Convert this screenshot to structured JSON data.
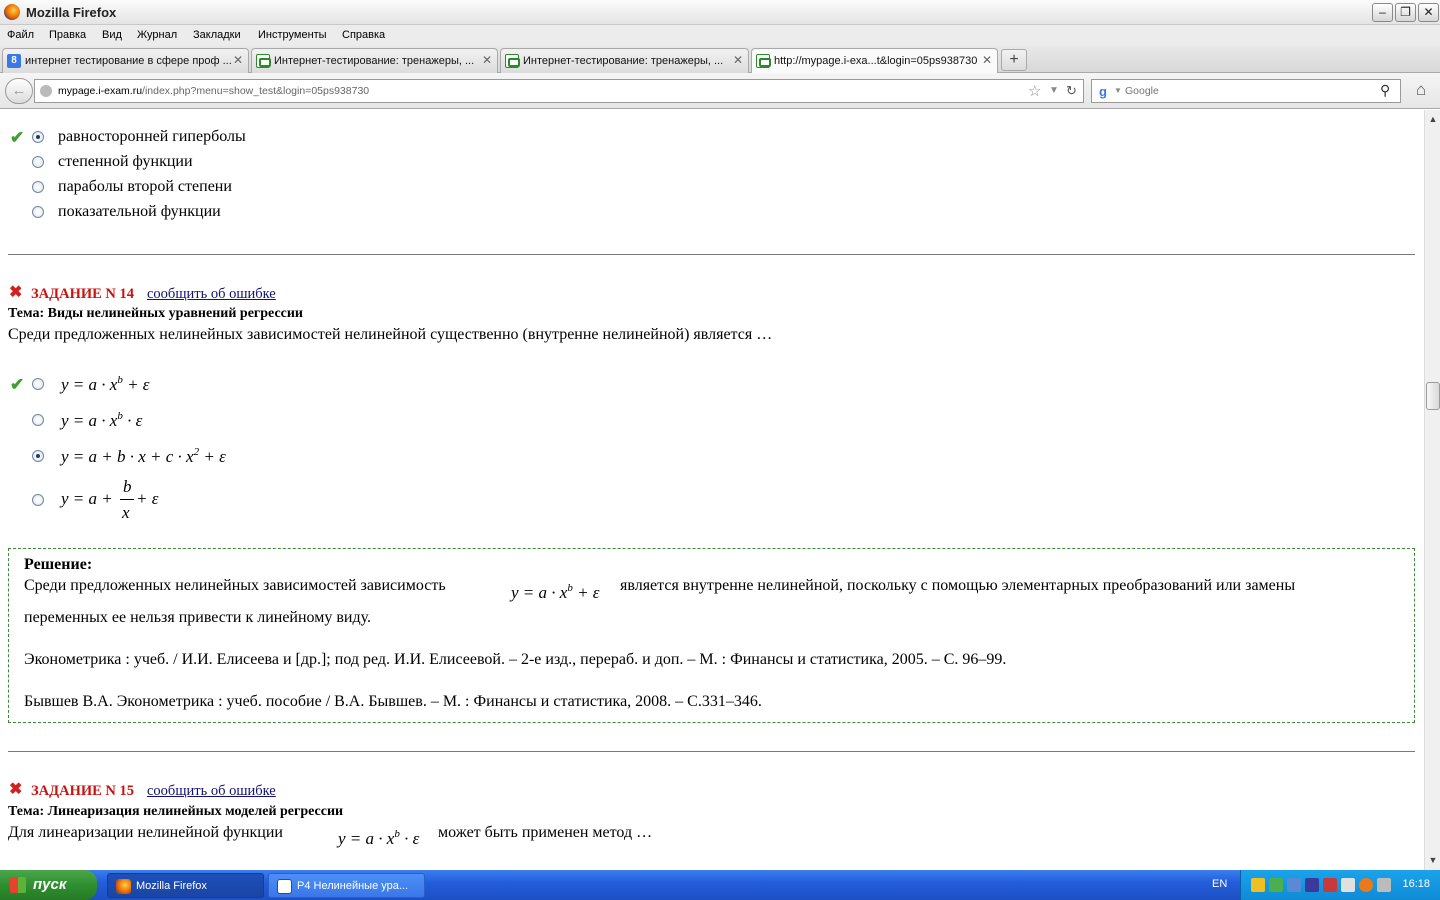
{
  "window": {
    "title": "Mozilla Firefox"
  },
  "menu": [
    "Файл",
    "Правка",
    "Вид",
    "Журнал",
    "Закладки",
    "Инструменты",
    "Справка"
  ],
  "tabs": [
    {
      "label": "интернет тестирование в сфере проф ...",
      "icon": "google-favicon-icon"
    },
    {
      "label": "Интернет-тестирование: тренажеры, ...",
      "icon": "iexam-favicon-icon"
    },
    {
      "label": "Интернет-тестирование: тренажеры, ...",
      "icon": "iexam-favicon-icon"
    },
    {
      "label": "http://mypage.i-exa...t&login=05ps938730",
      "icon": "iexam-favicon-icon"
    }
  ],
  "address": {
    "domain": "mypage.i-exam.ru",
    "path": "/index.php?menu=show_test&login=05ps938730"
  },
  "search": {
    "placeholder": "Google"
  },
  "prev_options": [
    {
      "text": "равносторонней гиперболы",
      "checked": true,
      "correct": true
    },
    {
      "text": "степенной функции",
      "checked": false
    },
    {
      "text": "параболы второй степени",
      "checked": false
    },
    {
      "text": "показательной функции",
      "checked": false
    }
  ],
  "task14": {
    "header": "ЗАДАНИЕ N 14",
    "report": "сообщить об ошибке",
    "topic": "Тема: Виды нелинейных уравнений регрессии",
    "question": "Среди предложенных нелинейных зависимостей нелинейной существенно (внутренне нелинейной) является …",
    "options": {
      "o1": {
        "text": "y = a · x",
        "sup": "b",
        "rest": " + ε"
      },
      "o2": {
        "text": "y = a · x",
        "sup": "b",
        "rest": " · ε"
      },
      "o3": {
        "text": "y = a + b · x + c · x",
        "sup": "2",
        "rest": " + ε"
      },
      "o4": {
        "pre": "y = a +",
        "num": "b",
        "den": "x",
        "post": "+ ε"
      }
    },
    "solution": {
      "title": "Решение:",
      "text1": "Среди предложенных нелинейных зависимостей зависимость",
      "formula": "y = a · x",
      "formula_sup": "b",
      "formula_rest": " + ε",
      "text2": "является внутренне нелинейной, поскольку с помощью элементарных преобразований или замены",
      "text3": "переменных ее нельзя привести к линейному виду.",
      "ref1": "Эконометрика : учеб. / И.И. Елисеева и [др.]; под ред. И.И. Елисеевой. – 2-е изд., перераб. и доп. – М. : Финансы и статистика, 2005. – С. 96–99.",
      "ref2": "Бывшев В.А. Эконометрика : учеб. пособие / В.А. Бывшев. – М. : Финансы и статистика, 2008. – С.331–346."
    }
  },
  "task15": {
    "header": "ЗАДАНИЕ N 15",
    "report": "сообщить об ошибке",
    "topic": "Тема: Линеаризация нелинейных моделей регрессии",
    "q_pre": "Для линеаризации  нелинейной функции",
    "formula": "y = a · x",
    "formula_sup": "b",
    "formula_rest": " · ε",
    "q_post": "может быть применен метод …"
  },
  "taskbar": {
    "start": "пуск",
    "items": [
      "Mozilla Firefox",
      "P4 Нелинейные ура..."
    ],
    "lang": "EN",
    "clock": "16:18"
  }
}
